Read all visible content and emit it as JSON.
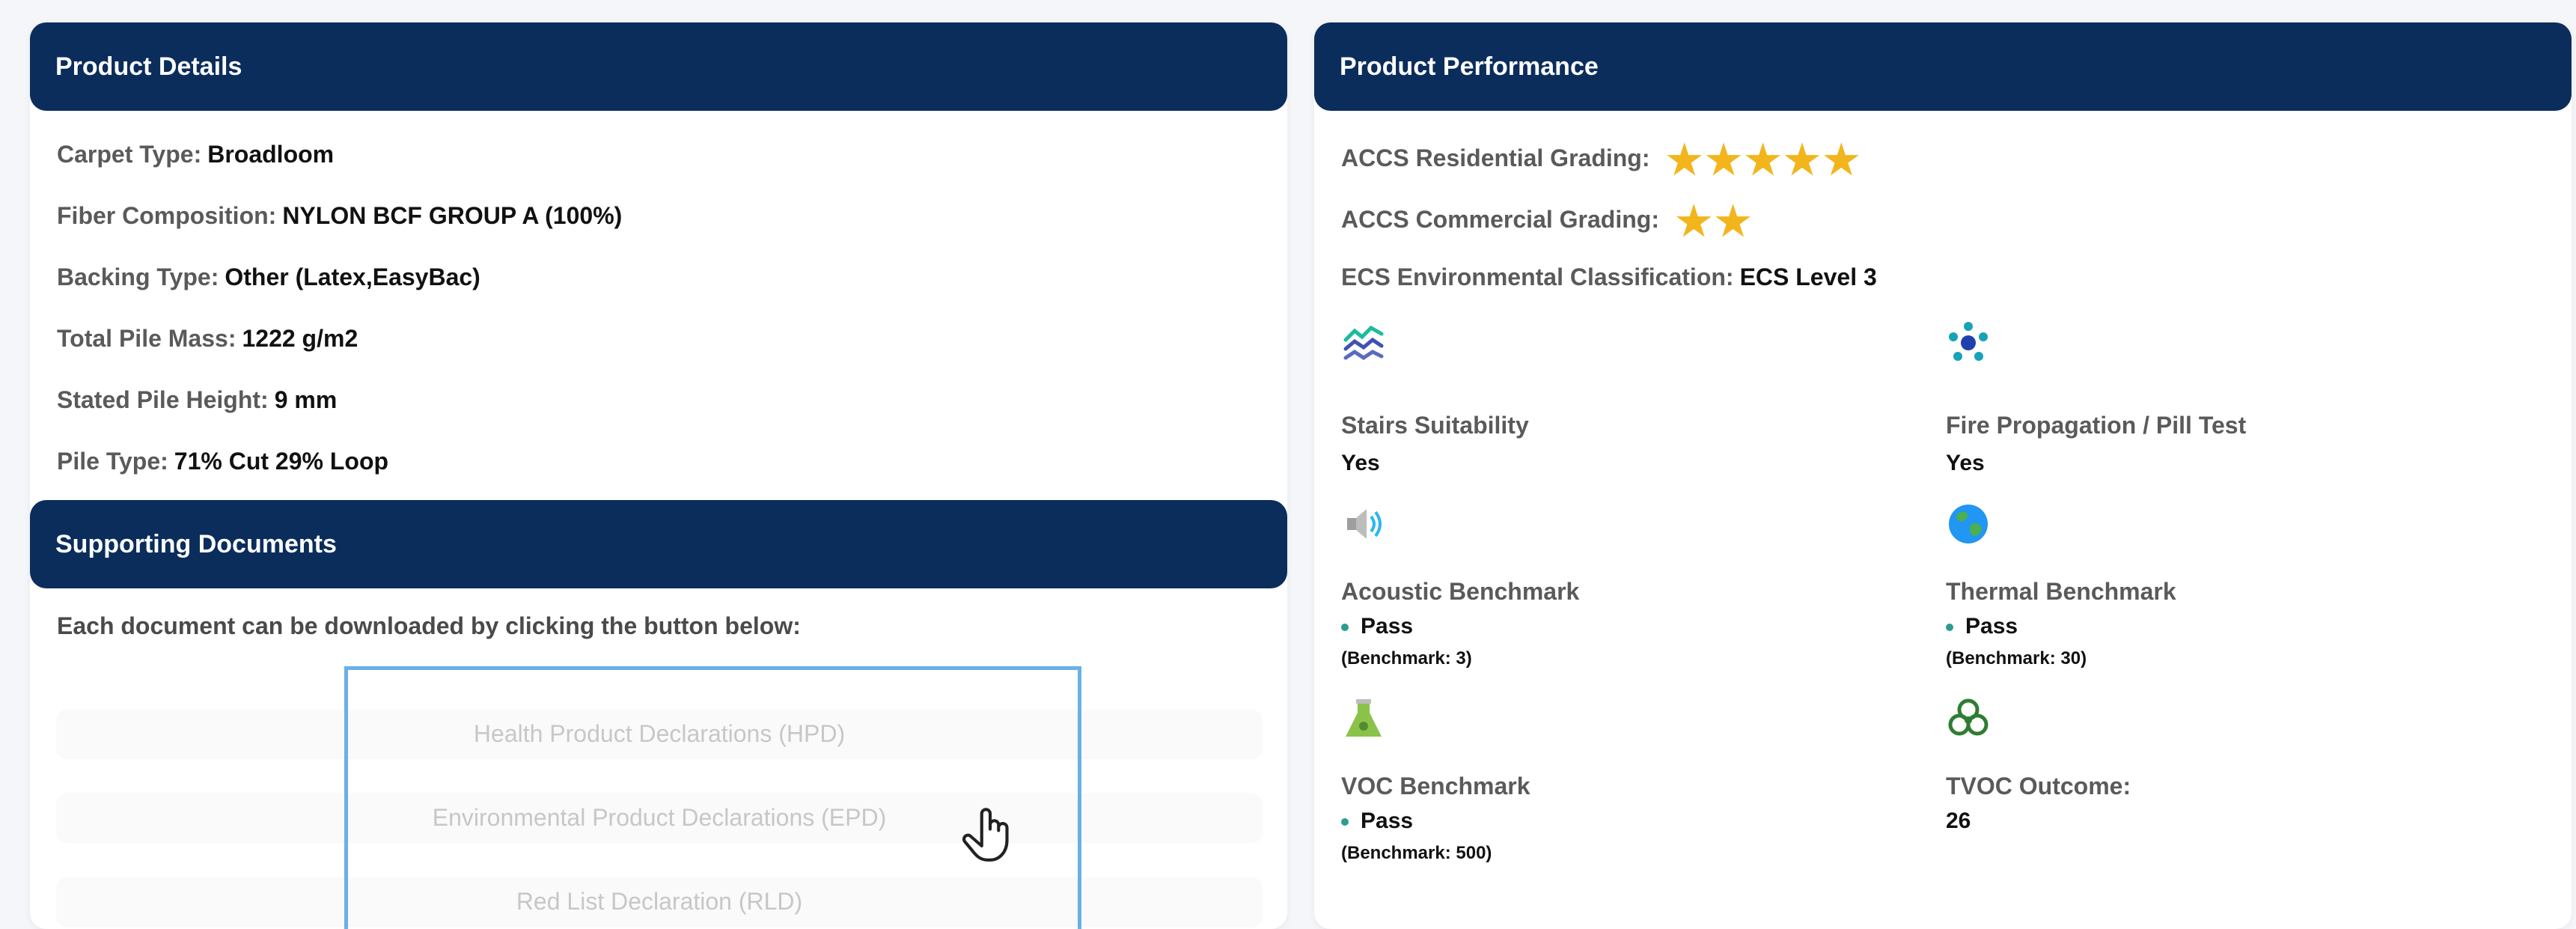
{
  "product_details": {
    "title": "Product Details",
    "fields": [
      {
        "label": "Carpet Type:",
        "value": "Broadloom"
      },
      {
        "label": "Fiber Composition:",
        "value": "NYLON BCF GROUP A (100%)"
      },
      {
        "label": "Backing Type:",
        "value": "Other (Latex,EasyBac)"
      },
      {
        "label": "Total Pile Mass:",
        "value": "1222 g/m2"
      },
      {
        "label": "Stated Pile Height:",
        "value": "9 mm"
      },
      {
        "label": "Pile Type:",
        "value": "71% Cut 29% Loop"
      }
    ]
  },
  "supporting_documents": {
    "title": "Supporting Documents",
    "intro": "Each document can be downloaded by clicking the button below:",
    "buttons": [
      "Health Product Declarations (HPD)",
      "Environmental Product Declarations (EPD)",
      "Red List Declaration (RLD)"
    ]
  },
  "product_performance": {
    "title": "Product Performance",
    "residential_label": "ACCS Residential Grading:",
    "residential_stars": 5,
    "commercial_label": "ACCS Commercial Grading:",
    "commercial_stars": 2,
    "ecs_label": "ECS Environmental Classification:",
    "ecs_value": "ECS Level 3",
    "star_color": "#f2b51c",
    "metrics": {
      "stairs": {
        "title": "Stairs Suitability",
        "value": "Yes",
        "icon": "stairs-icon"
      },
      "fire": {
        "title": "Fire Propagation / Pill Test",
        "value": "Yes",
        "icon": "fire-test-icon"
      },
      "acoustic": {
        "title": "Acoustic Benchmark",
        "value": "Pass",
        "bench": "(Benchmark: 3)",
        "icon": "speaker-icon"
      },
      "thermal": {
        "title": "Thermal Benchmark",
        "value": "Pass",
        "bench": "(Benchmark: 30)",
        "icon": "globe-icon"
      },
      "voc": {
        "title": "VOC Benchmark",
        "value": "Pass",
        "bench": "(Benchmark: 500)",
        "icon": "flask-icon"
      },
      "tvoc": {
        "title": "TVOC Outcome:",
        "value": "26",
        "icon": "biohazard-icon"
      }
    }
  },
  "colors": {
    "header_bg": "#0b2d5c",
    "highlight_border": "#6ab0e6",
    "pass_dot": "#2a9d8f"
  }
}
